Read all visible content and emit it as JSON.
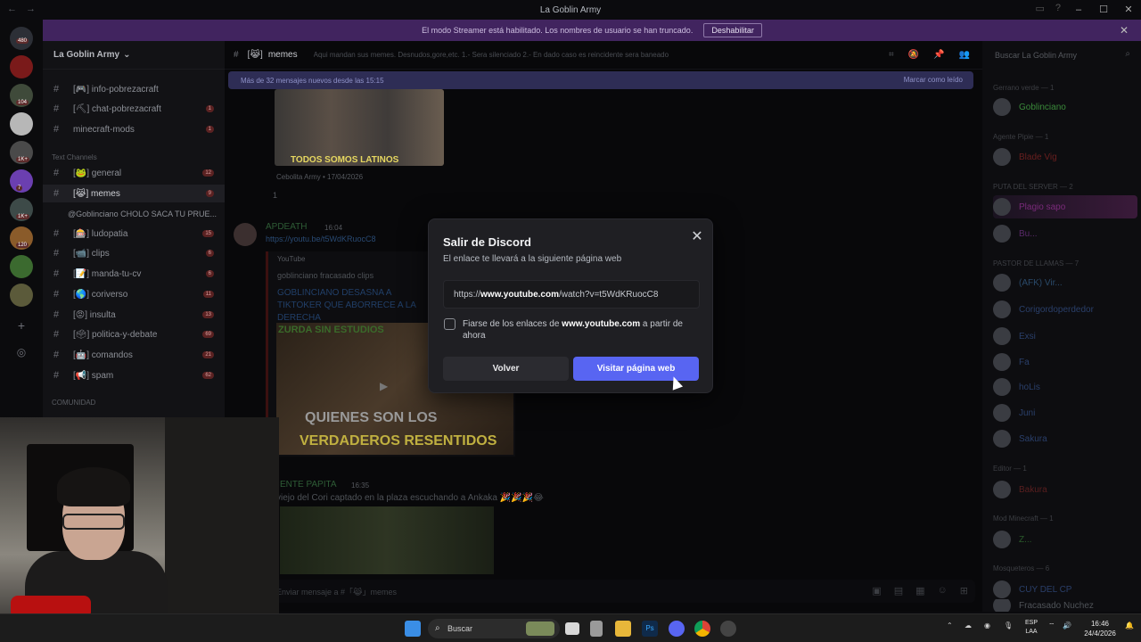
{
  "window": {
    "title": "La Goblin Army"
  },
  "streamer_banner": {
    "text": "El modo Streamer está habilitado. Los nombres de usuario se han truncado.",
    "disable_label": "Deshabilitar"
  },
  "rail": {
    "badges": [
      "480",
      "104",
      "1K+",
      "7",
      "1K+",
      "120"
    ]
  },
  "channels": {
    "server_name": "La Goblin Army",
    "items": [
      {
        "name": "info-pobrezacraft",
        "prefix": "[🎮]",
        "badge": ""
      },
      {
        "name": "chat-pobrezacraft",
        "prefix": "[⛏]",
        "badge": "1"
      },
      {
        "name": "minecraft-mods",
        "prefix": "",
        "badge": "1"
      }
    ],
    "category_text": "Text Channels",
    "text_channels": [
      {
        "name": "general",
        "prefix": "[🐸]",
        "badge": "12"
      },
      {
        "name": "memes",
        "prefix": "[😹]",
        "badge": "9"
      },
      {
        "name": "ludopatia",
        "prefix": "[🎰]",
        "badge": "15"
      },
      {
        "name": "clips",
        "prefix": "[📹]",
        "badge": "6"
      },
      {
        "name": "manda-tu-cv",
        "prefix": "[📝]",
        "badge": "6"
      },
      {
        "name": "coriverso",
        "prefix": "[🌎]",
        "badge": "11"
      },
      {
        "name": "insulta",
        "prefix": "[😡]",
        "badge": "13"
      },
      {
        "name": "politica-y-debate",
        "prefix": "[🗳]",
        "badge": "69"
      },
      {
        "name": "comandos",
        "prefix": "[🤖]",
        "badge": "21"
      },
      {
        "name": "spam",
        "prefix": "[📢]",
        "badge": "62"
      }
    ],
    "thread_preview": "@Goblinciano CHOLO SACA TU PRUE...",
    "category_community": "COMUNIDAD"
  },
  "chat": {
    "channel_name": "memes",
    "channel_prefix": "[😹]",
    "topic": "Aqui mandan sus memes. Desnudos,gore,etc. 1.- Sera silenciado 2.- En dado caso es reincidente sera baneado",
    "new_messages": "Más de 32 mensajes nuevos desde las 15:15",
    "mark_read": "Marcar como leído",
    "meme_caption": "TODOS SOMOS LATINOS",
    "msg1_meta": "Cebolita Army • 17/04/2026",
    "reaction_count": "1",
    "msg2_author": "APDEATH",
    "msg2_time": "16:04",
    "msg2_link": "https://youtu.be/t5WdKRuocC8",
    "embed_provider": "YouTube",
    "embed_channel": "goblinciano fracasado clips",
    "embed_title": "GOBLINCIANO DESASNA A TIKTOKER QUE ABORRECE A LA DERECHA",
    "video_text1": "ZURDA SIN ESTUDIOS",
    "video_cap1": "QUIENES SON LOS",
    "video_cap2": "VERDADEROS RESENTIDOS",
    "msg3_author": "ENTE PAPITA",
    "msg3_time": "16:35",
    "msg3_text": "viejo del Cori captado en la plaza escuchando a Ankaka 🎉🎉🎉😂",
    "composer_placeholder": "Enviar mensaje a #「😹」memes"
  },
  "members": {
    "search_placeholder": "Buscar La Goblin Army",
    "sections": [
      {
        "title": "Gerrano verde — 1",
        "members": [
          "Goblinciano"
        ]
      },
      {
        "title": "Agente Pipie — 1",
        "members": [
          "Blade Vig"
        ]
      },
      {
        "title": "PUTA DEL SERVER — 2",
        "members": [
          "Plagio sapo",
          "Bu..."
        ]
      },
      {
        "title": "PASTOR DE LLAMAS — 7",
        "members": [
          "(AFK) Vir...",
          "Corigordoperdedor",
          "Exsi",
          "Fa",
          "hoLis",
          "Juni",
          "Sakura"
        ]
      },
      {
        "title": "Editor — 1",
        "members": [
          "Bakura"
        ]
      },
      {
        "title": "Mod Minecraft — 1",
        "members": [
          "Z..."
        ]
      },
      {
        "title": "Mosqueteros — 6",
        "members": [
          "CUY DEL CP",
          "Fracasado Nuchez"
        ]
      }
    ]
  },
  "modal": {
    "title": "Salir de Discord",
    "subtitle": "El enlace te llevará a la siguiente página web",
    "url_prefix": "https://",
    "url_domain": "www.youtube.com",
    "url_path": "/watch?v=t5WdKRuocC8",
    "trust_before": "Fiarse de los enlaces de ",
    "trust_domain": "www.youtube.com",
    "trust_after": " a partir de ahora",
    "back_label": "Volver",
    "visit_label": "Visitar página web"
  },
  "taskbar": {
    "search_label": "Buscar",
    "lang_top": "ESP",
    "lang_bottom": "LAA",
    "time": "16:46",
    "date": "24/4/2026"
  },
  "colors": {
    "accent": "#5865f2",
    "streamer_banner": "#41245f",
    "modal_bg": "#1f1f23"
  }
}
